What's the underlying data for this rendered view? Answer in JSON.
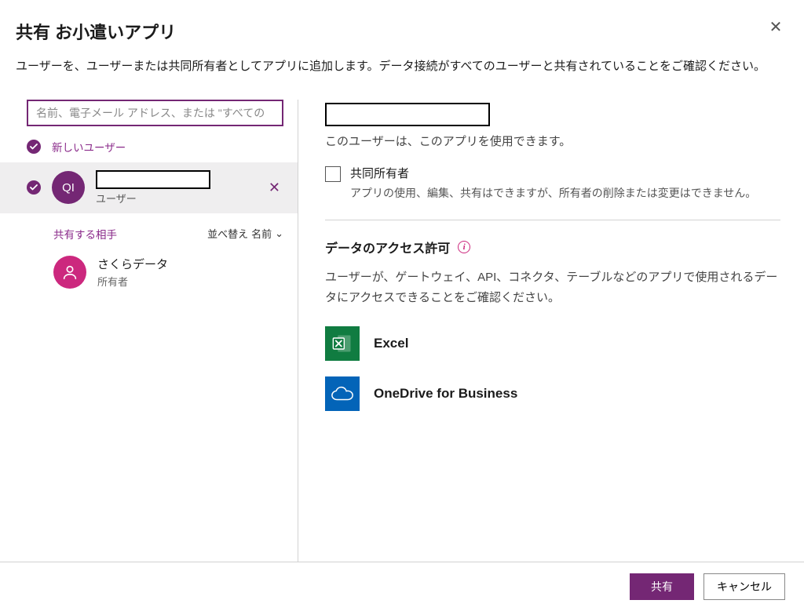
{
  "dialog": {
    "title": "共有 お小遣いアプリ",
    "subtitle": "ユーザーを、ユーザーまたは共同所有者としてアプリに追加します。データ接続がすべてのユーザーと共有されていることをご確認ください。",
    "close_label": "閉じる"
  },
  "search": {
    "placeholder": "名前、電子メール アドレス、または \"すべての"
  },
  "sidebar": {
    "new_user_label": "新しいユーザー",
    "selected_user": {
      "initials": "QI",
      "role": "ユーザー",
      "remove_label": "削除"
    },
    "share_with_label": "共有する相手",
    "sort_label_prefix": "並べ替え",
    "sort_field": "名前",
    "owner": {
      "name": "さくらデータ",
      "role": "所有者"
    }
  },
  "main": {
    "user_permission_desc": "このユーザーは、このアプリを使用できます。",
    "co_owner_label": "共同所有者",
    "co_owner_desc": "アプリの使用、編集、共有はできますが、所有者の削除または変更はできません。",
    "data_perm_title": "データのアクセス許可",
    "data_perm_info_label": "情報",
    "data_perm_desc": "ユーザーが、ゲートウェイ、API、コネクタ、テーブルなどのアプリで使用されるデータにアクセスできることをご確認ください。",
    "connectors": [
      {
        "label": "Excel",
        "tile": "excel"
      },
      {
        "label": "OneDrive for Business",
        "tile": "onedrive"
      }
    ]
  },
  "footer": {
    "share": "共有",
    "cancel": "キャンセル"
  }
}
